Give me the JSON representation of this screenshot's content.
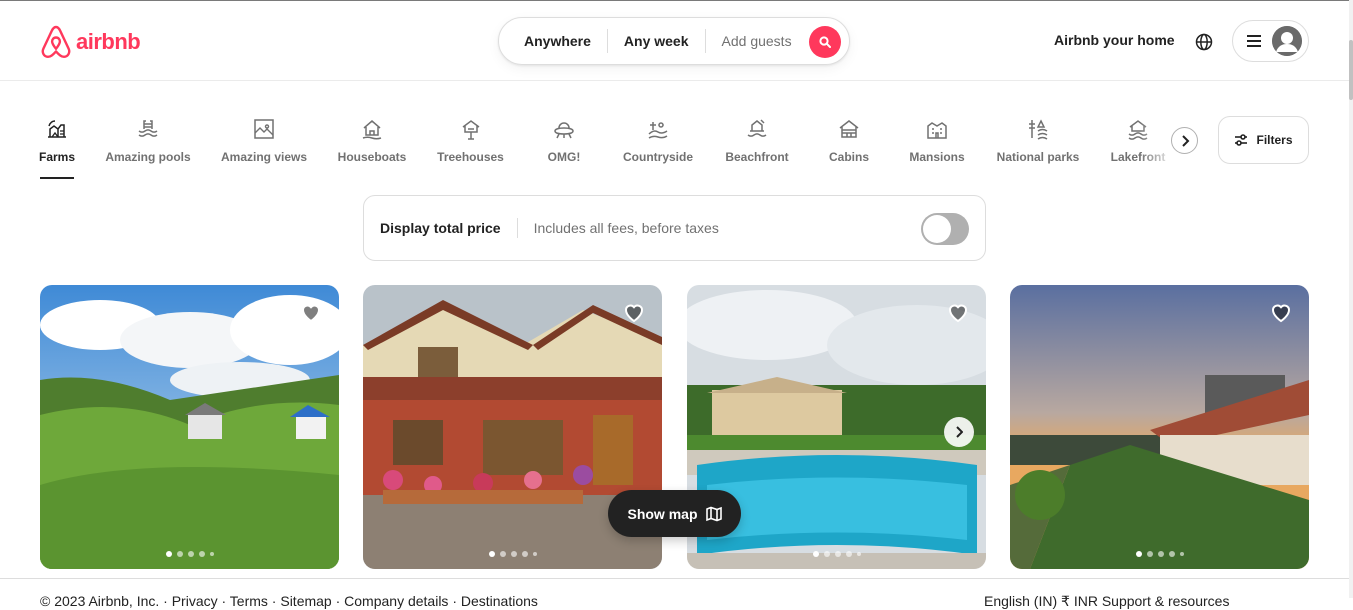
{
  "header": {
    "logo_text": "airbnb",
    "search": {
      "anywhere": "Anywhere",
      "any_week": "Any week",
      "add_guests": "Add guests"
    },
    "host_link": "Airbnb your home",
    "brand_color": "#ff385c"
  },
  "categories": [
    {
      "label": "Farms",
      "icon": "farm-icon",
      "active": true
    },
    {
      "label": "Amazing pools",
      "icon": "pool-icon"
    },
    {
      "label": "Amazing views",
      "icon": "view-icon"
    },
    {
      "label": "Houseboats",
      "icon": "houseboat-icon"
    },
    {
      "label": "Treehouses",
      "icon": "treehouse-icon"
    },
    {
      "label": "OMG!",
      "icon": "ufo-icon"
    },
    {
      "label": "Countryside",
      "icon": "countryside-icon"
    },
    {
      "label": "Beachfront",
      "icon": "beach-icon"
    },
    {
      "label": "Cabins",
      "icon": "cabin-icon"
    },
    {
      "label": "Mansions",
      "icon": "mansion-icon"
    },
    {
      "label": "National parks",
      "icon": "park-icon"
    },
    {
      "label": "Lakefront",
      "icon": "lake-icon"
    }
  ],
  "filters_label": "Filters",
  "price_toggle": {
    "title": "Display total price",
    "subtitle": "Includes all fees, before taxes",
    "on": false
  },
  "listings": [
    {
      "photo": "hillside-farmhouse",
      "photo_count": 5,
      "active_photo": 1
    },
    {
      "photo": "red-brick-cottage",
      "photo_count": 5,
      "active_photo": 1
    },
    {
      "photo": "villa-with-pool",
      "photo_count": 5,
      "active_photo": 1
    },
    {
      "photo": "sunset-farmstay",
      "photo_count": 5,
      "active_photo": 1
    }
  ],
  "show_map_label": "Show map",
  "footer": {
    "left": "© 2023 Airbnb, Inc. · Privacy · Terms · Sitemap · Company details · Destinations",
    "right": "English (IN)  ₹ INR  Support & resources"
  }
}
